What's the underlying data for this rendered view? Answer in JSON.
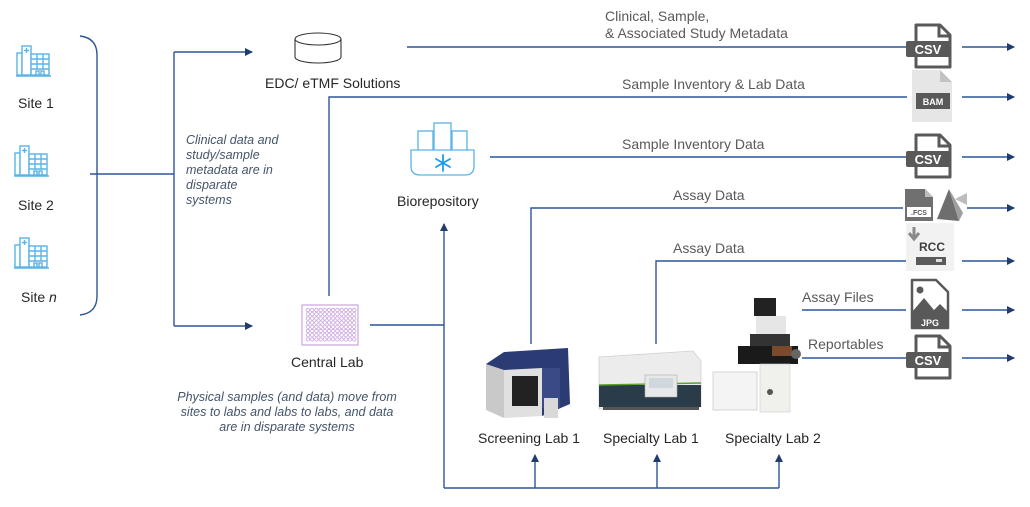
{
  "colors": {
    "connector": "#2f5597",
    "site_icon": "#5ab4e5",
    "biorepo_icon": "#5ab4e5",
    "snowflake": "#1e9ce8",
    "plate": "#c9a3e0",
    "file_icon": "#595959",
    "label_text": "#262626",
    "flow_text": "#595959",
    "note_text": "#44546a"
  },
  "sites": [
    {
      "label": "Site 1",
      "icon": "hospital-icon"
    },
    {
      "label": "Site 2",
      "icon": "hospital-icon"
    },
    {
      "label_prefix": "Site ",
      "label_italic": "n",
      "icon": "hospital-icon"
    }
  ],
  "nodes": {
    "edc": {
      "label": "EDC/ eTMF Solutions",
      "icon": "database-icon"
    },
    "biorepository": {
      "label": "Biorepository",
      "icon": "freezer-icon"
    },
    "central_lab": {
      "label": "Central Lab",
      "icon": "well-plate-icon"
    },
    "screening_lab_1": {
      "label": "Screening Lab 1",
      "icon": "flow-cytometer-icon"
    },
    "specialty_lab_1": {
      "label": "Specialty Lab 1",
      "icon": "analyzer-instrument-icon"
    },
    "specialty_lab_2": {
      "label": "Specialty Lab 2",
      "icon": "microscope-icon"
    }
  },
  "notes": {
    "clinical": [
      "Clinical data and",
      "study/sample",
      "metadata are in",
      "disparate",
      "systems"
    ],
    "physical": [
      "Physical samples (and data) move from",
      "sites to labs and labs to labs, and data",
      "are in disparate systems"
    ]
  },
  "flows": [
    {
      "label_lines": [
        "Clinical, Sample,",
        "& Associated Study Metadata"
      ],
      "file": "CSV",
      "icon": "csv-file-icon"
    },
    {
      "label_lines": [
        "Sample Inventory & Lab Data"
      ],
      "file": "BAM",
      "icon": "bam-file-icon"
    },
    {
      "label_lines": [
        "Sample Inventory Data"
      ],
      "file": "CSV",
      "icon": "csv-file-icon"
    },
    {
      "label_lines": [
        "Assay Data"
      ],
      "file": ".FCS",
      "icon": "fcs-file-icon"
    },
    {
      "label_lines": [
        "Assay Data"
      ],
      "file": "RCC",
      "icon": "rcc-file-icon"
    },
    {
      "label_lines": [
        "Assay Files"
      ],
      "file": "JPG",
      "icon": "jpg-file-icon"
    },
    {
      "label_lines": [
        "Reportables"
      ],
      "file": "CSV",
      "icon": "csv-file-icon"
    }
  ]
}
